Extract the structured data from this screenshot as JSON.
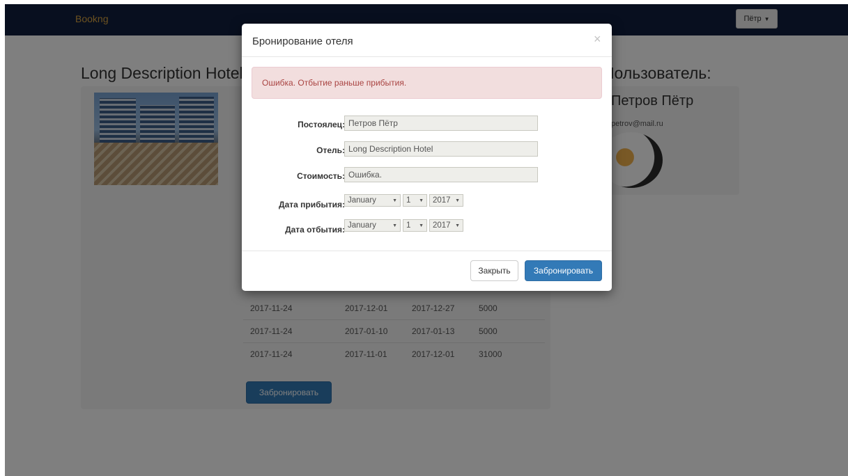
{
  "navbar": {
    "brand": "Bookng",
    "user_menu_label": "Пётр"
  },
  "page": {
    "hotel_title": "Long Description Hotel",
    "user_title": "Пользователь:",
    "user_name": "Петров Пётр",
    "user_email": "petrov@mail.ru",
    "bookings": [
      {
        "booked": "2017-11-24",
        "arrival": "2017-12-01",
        "departure": "2017-12-27",
        "price": "5000"
      },
      {
        "booked": "2017-11-24",
        "arrival": "2017-01-10",
        "departure": "2017-01-13",
        "price": "5000"
      },
      {
        "booked": "2017-11-24",
        "arrival": "2017-11-01",
        "departure": "2017-12-01",
        "price": "31000"
      }
    ],
    "book_button_label": "Забронировать"
  },
  "modal": {
    "title": "Бронирование отеля",
    "close_glyph": "×",
    "alert": "Ошибка. Отбытие раньше прибытия.",
    "fields": {
      "guest_label": "Постоялец:",
      "guest_value": "Петров Пётр",
      "hotel_label": "Отель:",
      "hotel_value": "Long Description Hotel",
      "cost_label": "Стоимость:",
      "cost_value": "Ошибка.",
      "arrival_label": "Дата прибытия:",
      "arrival": {
        "month": "January",
        "day": "1",
        "year": "2017"
      },
      "departure_label": "Дата отбытия:",
      "departure": {
        "month": "January",
        "day": "1",
        "year": "2017"
      }
    },
    "close_button_label": "Закрыть",
    "book_button_label": "Забронировать"
  },
  "colors": {
    "navbar": "#101e3f",
    "brand": "#d9a441",
    "primary": "#337ab7",
    "alert_bg": "#f2dede",
    "alert_text": "#a94442"
  }
}
